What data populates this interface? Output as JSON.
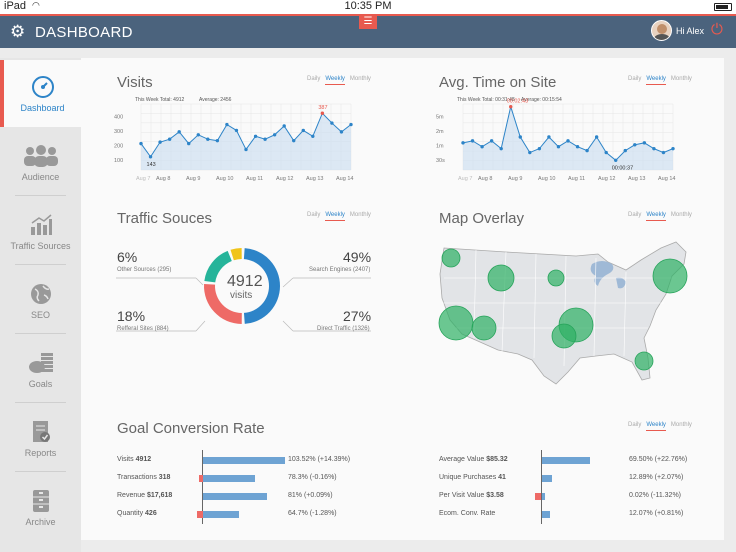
{
  "status_bar": {
    "device": "iPad",
    "time": "10:35 PM"
  },
  "header": {
    "title": "DASHBOARD",
    "greeting": "Hi Alex",
    "icons": [
      "gear-icon",
      "menu-icon",
      "power-icon"
    ]
  },
  "sidebar": {
    "items": [
      {
        "label": "Dashboard",
        "icon": "speedometer-icon",
        "active": true
      },
      {
        "label": "Audience",
        "icon": "people-icon"
      },
      {
        "label": "Traffic Sources",
        "icon": "bar-chart-icon"
      },
      {
        "label": "SEO",
        "icon": "globe-icon"
      },
      {
        "label": "Goals",
        "icon": "coins-icon"
      },
      {
        "label": "Reports",
        "icon": "report-icon"
      },
      {
        "label": "Archive",
        "icon": "archive-icon"
      }
    ]
  },
  "tabs": [
    "Daily",
    "Weekly",
    "Monthly"
  ],
  "visits": {
    "title": "Visits",
    "week_total": "This Week Total: 4912",
    "average": "Average: 2456",
    "peak_label": "387",
    "low_label": "143"
  },
  "avg_time": {
    "title": "Avg. Time on Site",
    "week_total": "This Week Total: 00:31:48",
    "average": "Average: 00:15:54",
    "peak_label": "00:02:43",
    "low_label": "00:00:37"
  },
  "traffic": {
    "title": "Traffic Souces",
    "total": "4912",
    "unit": "visits",
    "segments": [
      {
        "pct": "6%",
        "label": "Other Sources (295)",
        "color": "#f0c419"
      },
      {
        "pct": "49%",
        "label": "Search Engines (2407)",
        "color": "#2d84c8"
      },
      {
        "pct": "18%",
        "label": "Refferal Sites (884)",
        "color": "#26b49a"
      },
      {
        "pct": "27%",
        "label": "Direct Traffic (1326)",
        "color": "#ee6a66"
      }
    ]
  },
  "map": {
    "title": "Map Overlay"
  },
  "goals": {
    "title": "Goal Conversion Rate",
    "left": [
      {
        "name": "Visits",
        "value": "4912",
        "pct": "103.52% (+14.39%)"
      },
      {
        "name": "Transactions",
        "value": "318",
        "pct": "78.3% (-0.16%)"
      },
      {
        "name": "Revenue",
        "value": "$17,618",
        "pct": "81% (+0.09%)"
      },
      {
        "name": "Quantity",
        "value": "426",
        "pct": "64.7% (-1.28%)"
      }
    ],
    "right": [
      {
        "name": "Average Value",
        "value": "$85.32",
        "pct": "69.50% (+22.76%)"
      },
      {
        "name": "Unique Purchases",
        "value": "41",
        "pct": "12.89% (+2.07%)"
      },
      {
        "name": "Per Visit Value",
        "value": "$3.58",
        "pct": "0.02% (-11.32%)"
      },
      {
        "name": "Ecom. Conv. Rate",
        "value": "",
        "pct": "12.07% (+0.81%)"
      }
    ]
  },
  "chart_data": [
    {
      "type": "area",
      "title": "Visits",
      "x_ticks": [
        "Aug 7",
        "Aug 8",
        "Aug 9",
        "Aug 10",
        "Aug 11",
        "Aug 12",
        "Aug 13",
        "Aug 14"
      ],
      "y_ticks": [
        "100",
        "200",
        "300",
        "400"
      ],
      "ylim": [
        0,
        450
      ],
      "values": [
        180,
        90,
        190,
        210,
        260,
        180,
        240,
        210,
        200,
        310,
        270,
        140,
        230,
        210,
        240,
        300,
        200,
        270,
        230,
        387,
        320,
        260,
        310
      ]
    },
    {
      "type": "area",
      "title": "Avg. Time on Site",
      "x_ticks": [
        "Aug 7",
        "Aug 8",
        "Aug 9",
        "Aug 10",
        "Aug 11",
        "Aug 12",
        "Aug 13",
        "Aug 14"
      ],
      "y_ticks": [
        "30s",
        "1m",
        "2m",
        "5m"
      ],
      "ylim": [
        0,
        170
      ],
      "values": [
        70,
        75,
        60,
        75,
        55,
        163,
        85,
        45,
        55,
        85,
        60,
        75,
        60,
        50,
        85,
        45,
        25,
        50,
        65,
        70,
        55,
        45,
        55
      ]
    },
    {
      "type": "pie",
      "title": "Traffic Souces",
      "categories": [
        "Other Sources",
        "Search Engines",
        "Refferal Sites",
        "Direct Traffic"
      ],
      "values": [
        295,
        2407,
        884,
        1326
      ]
    }
  ],
  "colors": {
    "accent": "#e85a4f",
    "header": "#4b637d",
    "primary": "#2d84c8",
    "map_bubble": "#2eb164",
    "bar": "#6ea3d3"
  }
}
